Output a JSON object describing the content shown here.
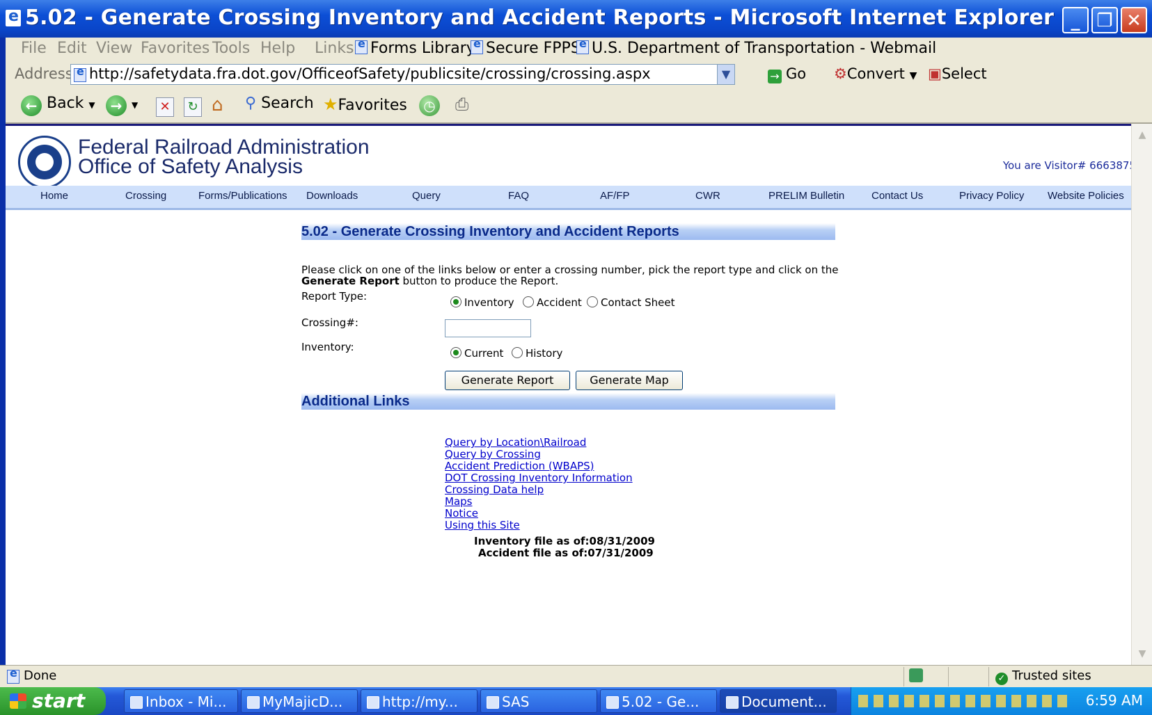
{
  "window": {
    "title": "5.02 - Generate Crossing Inventory and Accident Reports - Microsoft Internet Explorer",
    "min_glyph": "_",
    "max_glyph": "❐",
    "close_glyph": "✕"
  },
  "menu": {
    "items": [
      "File",
      "Edit",
      "View",
      "Favorites",
      "Tools",
      "Help"
    ],
    "links_label": "Links",
    "links": [
      "Forms Library",
      "Secure FPPS",
      "U.S. Department of Transportation - Webmail"
    ]
  },
  "address": {
    "label": "Address",
    "url": "http://safetydata.fra.dot.gov/OfficeofSafety/publicsite/crossing/crossing.aspx",
    "go_label": "Go",
    "convert_label": "Convert",
    "select_label": "Select"
  },
  "toolbar": {
    "back_label": "Back",
    "search_label": "Search",
    "favorites_label": "Favorites"
  },
  "header": {
    "agency_line1": "Federal Railroad Administration",
    "agency_line2": "Office of Safety Analysis",
    "visitor_text": "You are Visitor# 6663875"
  },
  "nav": [
    "Home",
    "Crossing",
    "Forms/Publications",
    "Downloads",
    "Query",
    "FAQ",
    "AF/FP",
    "CWR",
    "PRELIM Bulletin",
    "Contact Us",
    "Privacy Policy",
    "Website Policies"
  ],
  "form": {
    "section_title": "5.02 - Generate Crossing Inventory and Accident Reports",
    "intro_line1": "Please click on one of the links below or enter a crossing number, pick the report type and click on the",
    "intro_bold": "Generate Report",
    "intro_rest": " button to produce the Report.",
    "report_type_label": "Report Type:",
    "report_types": [
      "Inventory",
      "Accident",
      "Contact Sheet"
    ],
    "selected_report_type": "Inventory",
    "crossing_label": "Crossing#:",
    "crossing_value": "",
    "inventory_label": "Inventory:",
    "inventory_options": [
      "Current",
      "History"
    ],
    "selected_inventory": "Current",
    "generate_report_label": "Generate Report",
    "generate_map_label": "Generate Map"
  },
  "additional": {
    "section_title": "Additional Links",
    "links": [
      "Query by Location\\Railroad",
      "Query by Crossing",
      "Accident Prediction (WBAPS)",
      "DOT Crossing Inventory Information",
      "Crossing Data help",
      "Maps",
      "Notice",
      "Using this Site"
    ],
    "inventory_file": "Inventory file as of:08/31/2009",
    "accident_file": "Accident file as of:07/31/2009"
  },
  "status": {
    "text": "Done",
    "zone": "Trusted sites"
  },
  "taskbar": {
    "start_label": "start",
    "tasks": [
      "Inbox - Mi...",
      "MyMajicD...",
      "http://my...",
      "SAS",
      "5.02 - Ge...",
      "Document..."
    ],
    "clock": "6:59 AM"
  },
  "colors": {
    "title_bar": "#0c4fd6",
    "nav_bar": "#cfe0fb",
    "section_header_text": "#0a2a8a",
    "link": "#0000cc"
  }
}
